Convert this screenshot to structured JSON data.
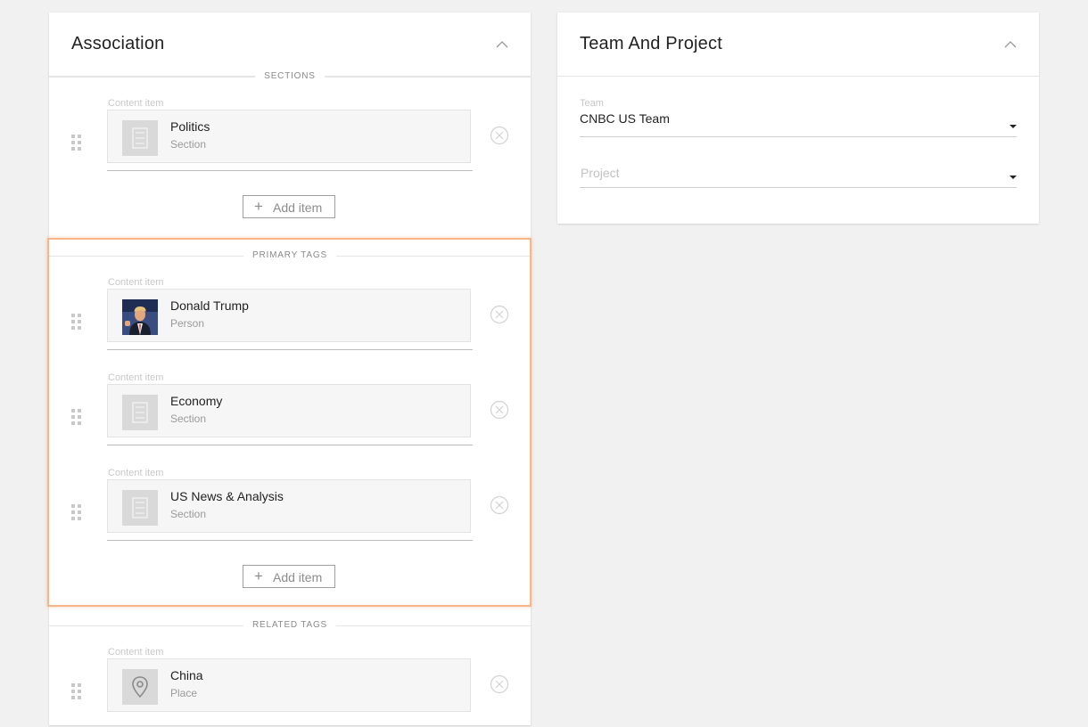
{
  "association": {
    "title": "Association",
    "sections": [
      {
        "label": "SECTIONS",
        "items": [
          {
            "content_label": "Content item",
            "name": "Politics",
            "type": "Section",
            "thumb": "section-icon"
          }
        ],
        "add_label": "Add item"
      },
      {
        "label": "PRIMARY TAGS",
        "items": [
          {
            "content_label": "Content item",
            "name": "Donald Trump",
            "type": "Person",
            "thumb": "person-photo"
          },
          {
            "content_label": "Content item",
            "name": "Economy",
            "type": "Section",
            "thumb": "section-icon"
          },
          {
            "content_label": "Content item",
            "name": "US News & Analysis",
            "type": "Section",
            "thumb": "section-icon"
          }
        ],
        "add_label": "Add item"
      },
      {
        "label": "RELATED TAGS",
        "items": [
          {
            "content_label": "Content item",
            "name": "China",
            "type": "Place",
            "thumb": "location-pin-icon"
          }
        ]
      }
    ]
  },
  "team_project": {
    "title": "Team And Project",
    "team": {
      "label": "Team",
      "value": "CNBC US Team"
    },
    "project": {
      "placeholder": "Project"
    }
  },
  "colors": {
    "background": "#f1f1f1",
    "highlight": "#f7b58a"
  }
}
